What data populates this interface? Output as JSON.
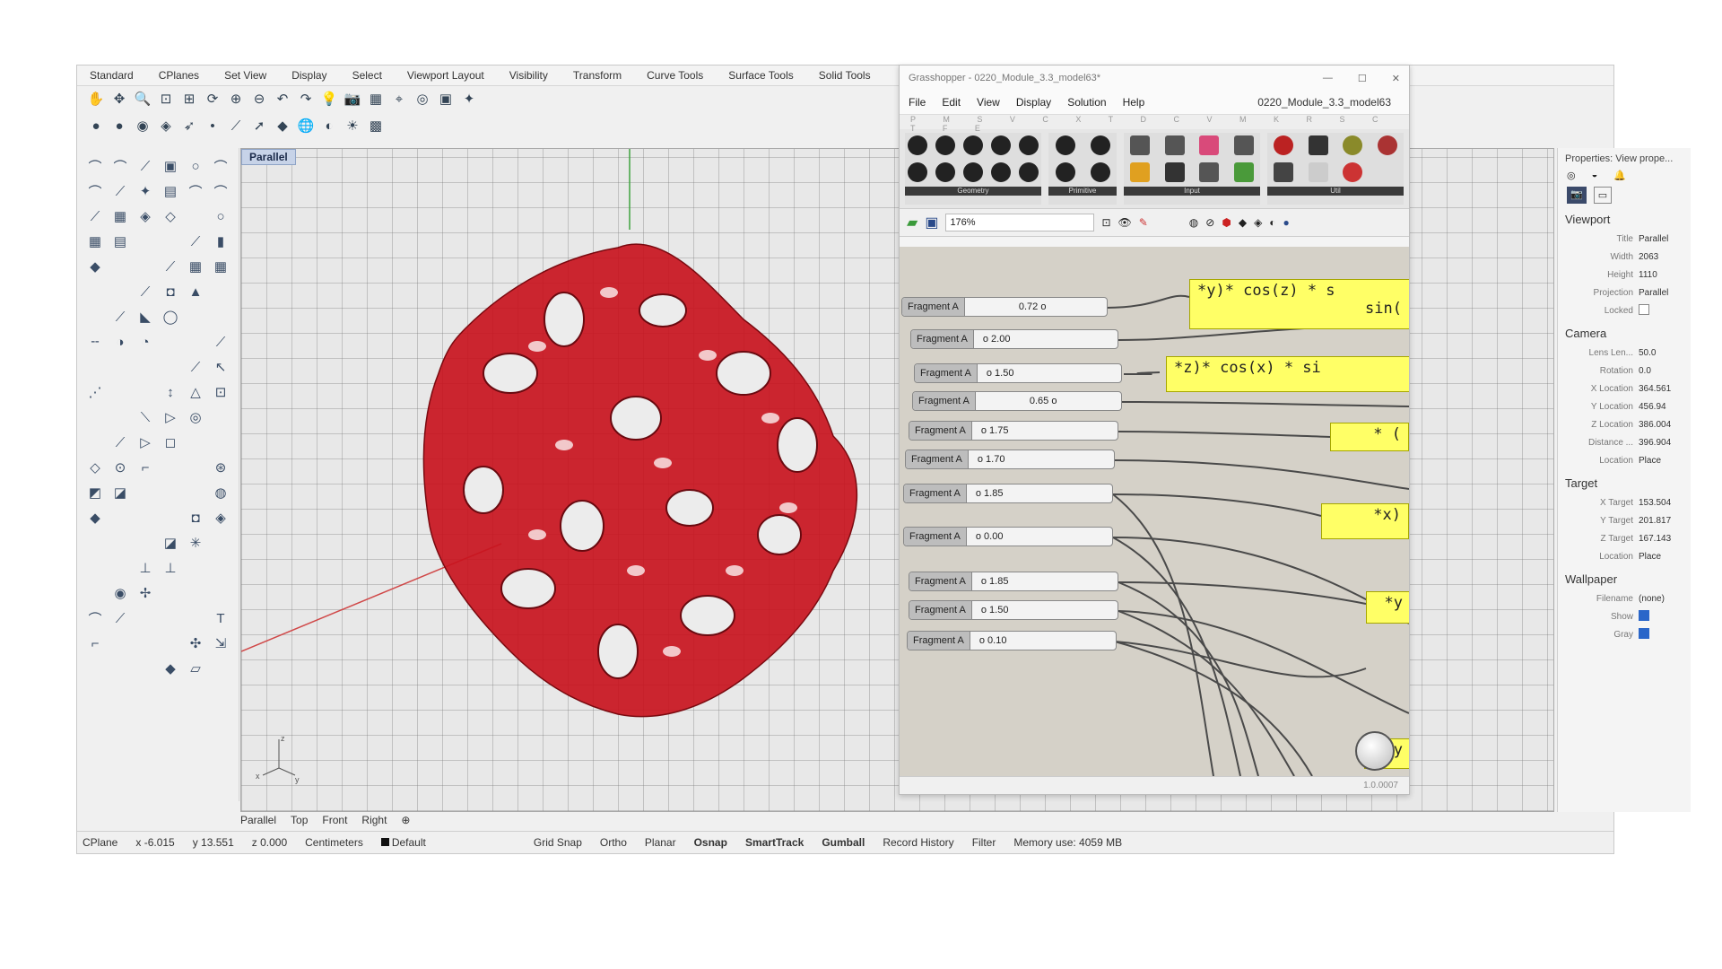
{
  "toolbar_tabs": [
    "Standard",
    "CPlanes",
    "Set View",
    "Display",
    "Select",
    "Viewport Layout",
    "Visibility",
    "Transform",
    "Curve Tools",
    "Surface Tools",
    "Solid Tools"
  ],
  "viewport": {
    "label": "Parallel",
    "tabs": [
      "Parallel",
      "Top",
      "Front",
      "Right"
    ]
  },
  "status": {
    "cplane": "CPlane",
    "x": "x -6.015",
    "y": "y 13.551",
    "z": "z 0.000",
    "units": "Centimeters",
    "layer": "Default",
    "toggles": [
      "Grid Snap",
      "Ortho",
      "Planar",
      "Osnap",
      "SmartTrack",
      "Gumball",
      "Record History",
      "Filter"
    ],
    "memory": "Memory use: 4059 MB"
  },
  "grasshopper": {
    "title": "Grasshopper - 0220_Module_3.3_model63*",
    "menu": [
      "File",
      "Edit",
      "View",
      "Display",
      "Solution",
      "Help"
    ],
    "doc_name": "0220_Module_3.3_model63",
    "tab_letters": "P M S V C X T D C V M K R S C T F E",
    "palette_groups": [
      "Geometry",
      "Primitive",
      "Input",
      "Util"
    ],
    "zoom": "176%",
    "sliders": [
      {
        "label": "Fragment A",
        "value": "0.72"
      },
      {
        "label": "Fragment A",
        "value": "2.00"
      },
      {
        "label": "Fragment A",
        "value": "1.50"
      },
      {
        "label": "Fragment A",
        "value": "0.65"
      },
      {
        "label": "Fragment A",
        "value": "1.75"
      },
      {
        "label": "Fragment A",
        "value": "1.70"
      },
      {
        "label": "Fragment A",
        "value": "1.85"
      },
      {
        "label": "Fragment A",
        "value": "0.00"
      },
      {
        "label": "Fragment A",
        "value": "1.85"
      },
      {
        "label": "Fragment A",
        "value": "1.50"
      },
      {
        "label": "Fragment A",
        "value": "0.10"
      }
    ],
    "expressions": [
      "*y)* cos(z) * s",
      "sin(",
      "*z)* cos(x) * si",
      "* (",
      "*x)",
      "*y",
      "y"
    ],
    "version": "1.0.0007"
  },
  "properties": {
    "title": "Properties: View prope...",
    "sections": {
      "viewport": {
        "heading": "Viewport",
        "rows": [
          [
            "Title",
            "Parallel"
          ],
          [
            "Width",
            "2063"
          ],
          [
            "Height",
            "1110"
          ],
          [
            "Projection",
            "Parallel"
          ],
          [
            "Locked",
            ""
          ]
        ]
      },
      "camera": {
        "heading": "Camera",
        "rows": [
          [
            "Lens Len...",
            "50.0"
          ],
          [
            "Rotation",
            "0.0"
          ],
          [
            "X Location",
            "364.561"
          ],
          [
            "Y Location",
            "456.94"
          ],
          [
            "Z Location",
            "386.004"
          ],
          [
            "Distance ...",
            "396.904"
          ],
          [
            "Location",
            "Place"
          ]
        ]
      },
      "target": {
        "heading": "Target",
        "rows": [
          [
            "X Target",
            "153.504"
          ],
          [
            "Y Target",
            "201.817"
          ],
          [
            "Z Target",
            "167.143"
          ],
          [
            "Location",
            "Place"
          ]
        ]
      },
      "wallpaper": {
        "heading": "Wallpaper",
        "rows": [
          [
            "Filename",
            "(none)"
          ],
          [
            "Show",
            ""
          ],
          [
            "Gray",
            ""
          ]
        ]
      }
    }
  },
  "colors": {
    "object_red": "#c8141e",
    "viewport_label": "#c7d3e8",
    "expression_yellow": "#ffff66",
    "canvas": "#d5d1c8"
  }
}
